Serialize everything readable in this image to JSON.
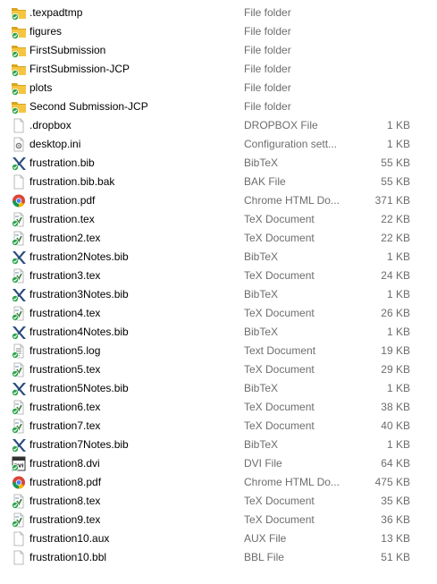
{
  "colors": {
    "folder": "#f5c542",
    "folder_dark": "#d9a520",
    "sync_check": "#2da44e",
    "bib_blue": "#2b4d7d",
    "tex_green": "#3a7a3a",
    "chrome_red": "#db4437",
    "chrome_yellow": "#f4b400",
    "chrome_green": "#0f9d58",
    "chrome_blue": "#4285f4"
  },
  "files": [
    {
      "name": ".texpadtmp",
      "type": "File folder",
      "size": "",
      "icon": "folder-icon"
    },
    {
      "name": "figures",
      "type": "File folder",
      "size": "",
      "icon": "folder-icon"
    },
    {
      "name": "FirstSubmission",
      "type": "File folder",
      "size": "",
      "icon": "folder-icon"
    },
    {
      "name": "FirstSubmission-JCP",
      "type": "File folder",
      "size": "",
      "icon": "folder-icon"
    },
    {
      "name": "plots",
      "type": "File folder",
      "size": "",
      "icon": "folder-icon"
    },
    {
      "name": "Second Submission-JCP",
      "type": "File folder",
      "size": "",
      "icon": "folder-icon"
    },
    {
      "name": ".dropbox",
      "type": "DROPBOX File",
      "size": "1 KB",
      "icon": "blank-file-icon"
    },
    {
      "name": "desktop.ini",
      "type": "Configuration sett...",
      "size": "1 KB",
      "icon": "settings-file-icon"
    },
    {
      "name": "frustration.bib",
      "type": "BibTeX",
      "size": "55 KB",
      "icon": "bibtex-icon"
    },
    {
      "name": "frustration.bib.bak",
      "type": "BAK File",
      "size": "55 KB",
      "icon": "blank-file-icon"
    },
    {
      "name": "frustration.pdf",
      "type": "Chrome HTML Do...",
      "size": "371 KB",
      "icon": "chrome-icon"
    },
    {
      "name": "frustration.tex",
      "type": "TeX Document",
      "size": "22 KB",
      "icon": "tex-icon"
    },
    {
      "name": "frustration2.tex",
      "type": "TeX Document",
      "size": "22 KB",
      "icon": "tex-icon"
    },
    {
      "name": "frustration2Notes.bib",
      "type": "BibTeX",
      "size": "1 KB",
      "icon": "bibtex-icon"
    },
    {
      "name": "frustration3.tex",
      "type": "TeX Document",
      "size": "24 KB",
      "icon": "tex-icon"
    },
    {
      "name": "frustration3Notes.bib",
      "type": "BibTeX",
      "size": "1 KB",
      "icon": "bibtex-icon"
    },
    {
      "name": "frustration4.tex",
      "type": "TeX Document",
      "size": "26 KB",
      "icon": "tex-icon"
    },
    {
      "name": "frustration4Notes.bib",
      "type": "BibTeX",
      "size": "1 KB",
      "icon": "bibtex-icon"
    },
    {
      "name": "frustration5.log",
      "type": "Text Document",
      "size": "19 KB",
      "icon": "text-file-icon"
    },
    {
      "name": "frustration5.tex",
      "type": "TeX Document",
      "size": "29 KB",
      "icon": "tex-icon"
    },
    {
      "name": "frustration5Notes.bib",
      "type": "BibTeX",
      "size": "1 KB",
      "icon": "bibtex-icon"
    },
    {
      "name": "frustration6.tex",
      "type": "TeX Document",
      "size": "38 KB",
      "icon": "tex-icon"
    },
    {
      "name": "frustration7.tex",
      "type": "TeX Document",
      "size": "40 KB",
      "icon": "tex-icon"
    },
    {
      "name": "frustration7Notes.bib",
      "type": "BibTeX",
      "size": "1 KB",
      "icon": "bibtex-icon"
    },
    {
      "name": "frustration8.dvi",
      "type": "DVI File",
      "size": "64 KB",
      "icon": "dvi-icon"
    },
    {
      "name": "frustration8.pdf",
      "type": "Chrome HTML Do...",
      "size": "475 KB",
      "icon": "chrome-icon"
    },
    {
      "name": "frustration8.tex",
      "type": "TeX Document",
      "size": "35 KB",
      "icon": "tex-icon"
    },
    {
      "name": "frustration9.tex",
      "type": "TeX Document",
      "size": "36 KB",
      "icon": "tex-icon"
    },
    {
      "name": "frustration10.aux",
      "type": "AUX File",
      "size": "13 KB",
      "icon": "blank-file-icon"
    },
    {
      "name": "frustration10.bbl",
      "type": "BBL File",
      "size": "51 KB",
      "icon": "blank-file-icon"
    }
  ]
}
